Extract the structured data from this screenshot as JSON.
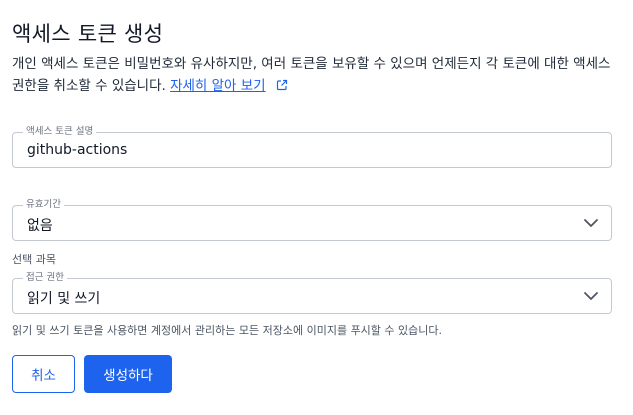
{
  "dialog": {
    "title": "액세스 토큰 생성",
    "description": "개인 액세스 토큰은 비밀번호와 유사하지만, 여러 토큰을 보유할 수 있으며 언제든지 각 토큰에 대한 액세스 권한을 취소할 수 있습니다. ",
    "learn_more_link": "자세히 알아 보기",
    "external_link_icon": "external-link-icon"
  },
  "token_description": {
    "label": "액세스 토큰 설명",
    "value": "github-actions"
  },
  "expiration": {
    "label": "유효기간",
    "value": "없음",
    "icon": "chevron-down-icon"
  },
  "optional_section": {
    "label": "선택 과목"
  },
  "access_scope": {
    "label": "접근 권한",
    "value": "읽기 및 쓰기",
    "icon": "chevron-down-icon",
    "helper": "읽기 및 쓰기 토큰을 사용하면 계정에서 관리하는 모든 저장소에 이미지를 푸시할 수 있습니다."
  },
  "actions": {
    "cancel_label": "취소",
    "create_label": "생성하다"
  },
  "colors": {
    "accent": "#1d63ed",
    "border": "#c4c9d1"
  }
}
